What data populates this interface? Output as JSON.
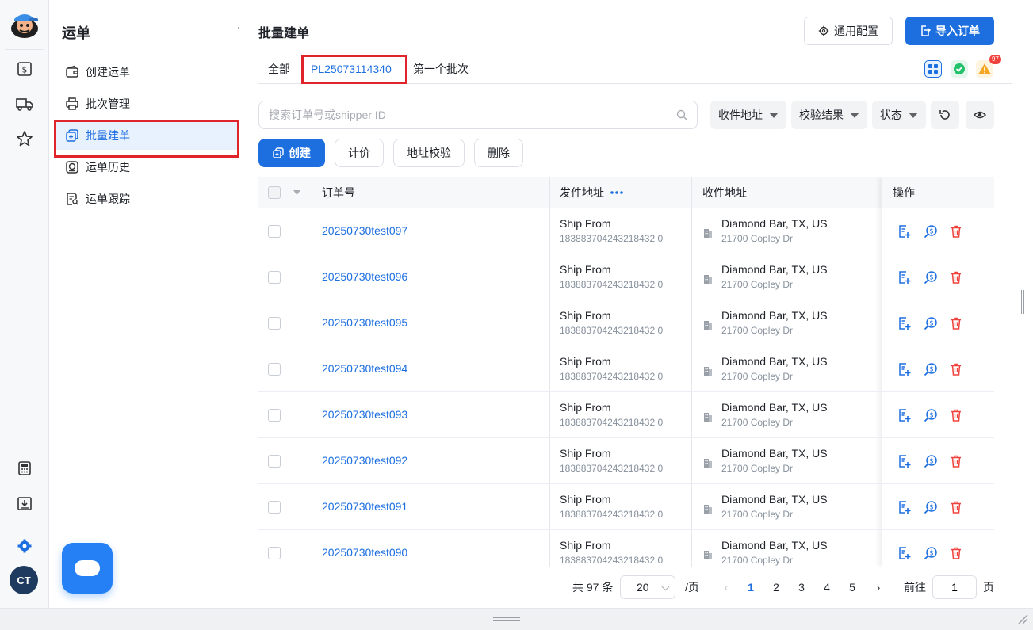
{
  "sidebar": {
    "title": "运单",
    "items": [
      {
        "label": "创建运单",
        "icon": "wallet-icon"
      },
      {
        "label": "批次管理",
        "icon": "printer-icon"
      },
      {
        "label": "批量建单",
        "icon": "batch-copy-icon"
      },
      {
        "label": "运单历史",
        "icon": "history-icon"
      },
      {
        "label": "运单跟踪",
        "icon": "tracking-icon"
      }
    ],
    "active_index": 2,
    "user_initials": "CT"
  },
  "header": {
    "title": "批量建单",
    "config_label": "通用配置",
    "import_label": "导入订单"
  },
  "tabs": [
    {
      "label": "全部"
    },
    {
      "label": "PL25073114340"
    },
    {
      "label": "第一个批次"
    }
  ],
  "active_tab": 1,
  "warning_count": "97",
  "search": {
    "placeholder": "搜索订单号或shipper ID",
    "value": ""
  },
  "filters": {
    "receiver": "收件地址",
    "validation": "校验结果",
    "status": "状态"
  },
  "actions": {
    "create": "创建",
    "price": "计价",
    "validate": "地址校验",
    "delete": "删除"
  },
  "table": {
    "headers": {
      "order_no": "订单号",
      "from": "发件地址",
      "to": "收件地址",
      "ops": "操作"
    },
    "rows": [
      {
        "order": "20250730test097",
        "from_name": "Ship From",
        "from_id": "183883704243218432 0",
        "to_city": "Diamond Bar, TX, US",
        "to_street": "21700 Copley Dr"
      },
      {
        "order": "20250730test096",
        "from_name": "Ship From",
        "from_id": "183883704243218432 0",
        "to_city": "Diamond Bar, TX, US",
        "to_street": "21700 Copley Dr"
      },
      {
        "order": "20250730test095",
        "from_name": "Ship From",
        "from_id": "183883704243218432 0",
        "to_city": "Diamond Bar, TX, US",
        "to_street": "21700 Copley Dr"
      },
      {
        "order": "20250730test094",
        "from_name": "Ship From",
        "from_id": "183883704243218432 0",
        "to_city": "Diamond Bar, TX, US",
        "to_street": "21700 Copley Dr"
      },
      {
        "order": "20250730test093",
        "from_name": "Ship From",
        "from_id": "183883704243218432 0",
        "to_city": "Diamond Bar, TX, US",
        "to_street": "21700 Copley Dr"
      },
      {
        "order": "20250730test092",
        "from_name": "Ship From",
        "from_id": "183883704243218432 0",
        "to_city": "Diamond Bar, TX, US",
        "to_street": "21700 Copley Dr"
      },
      {
        "order": "20250730test091",
        "from_name": "Ship From",
        "from_id": "183883704243218432 0",
        "to_city": "Diamond Bar, TX, US",
        "to_street": "21700 Copley Dr"
      },
      {
        "order": "20250730test090",
        "from_name": "Ship From",
        "from_id": "183883704243218432 0",
        "to_city": "Diamond Bar, TX, US",
        "to_street": "21700 Copley Dr"
      }
    ]
  },
  "pagination": {
    "total_label": "共 97 条",
    "page_size": "20",
    "per_page_label": "/页",
    "pages": [
      "1",
      "2",
      "3",
      "4",
      "5"
    ],
    "current": "1",
    "goto_label": "前往",
    "goto_value": "1",
    "page_suffix": "页"
  },
  "colors": {
    "primary": "#1d6fe0",
    "highlight_outline": "#e0242c",
    "delete": "#f0423c",
    "success": "#23c16b",
    "warning": "#f5a623"
  }
}
